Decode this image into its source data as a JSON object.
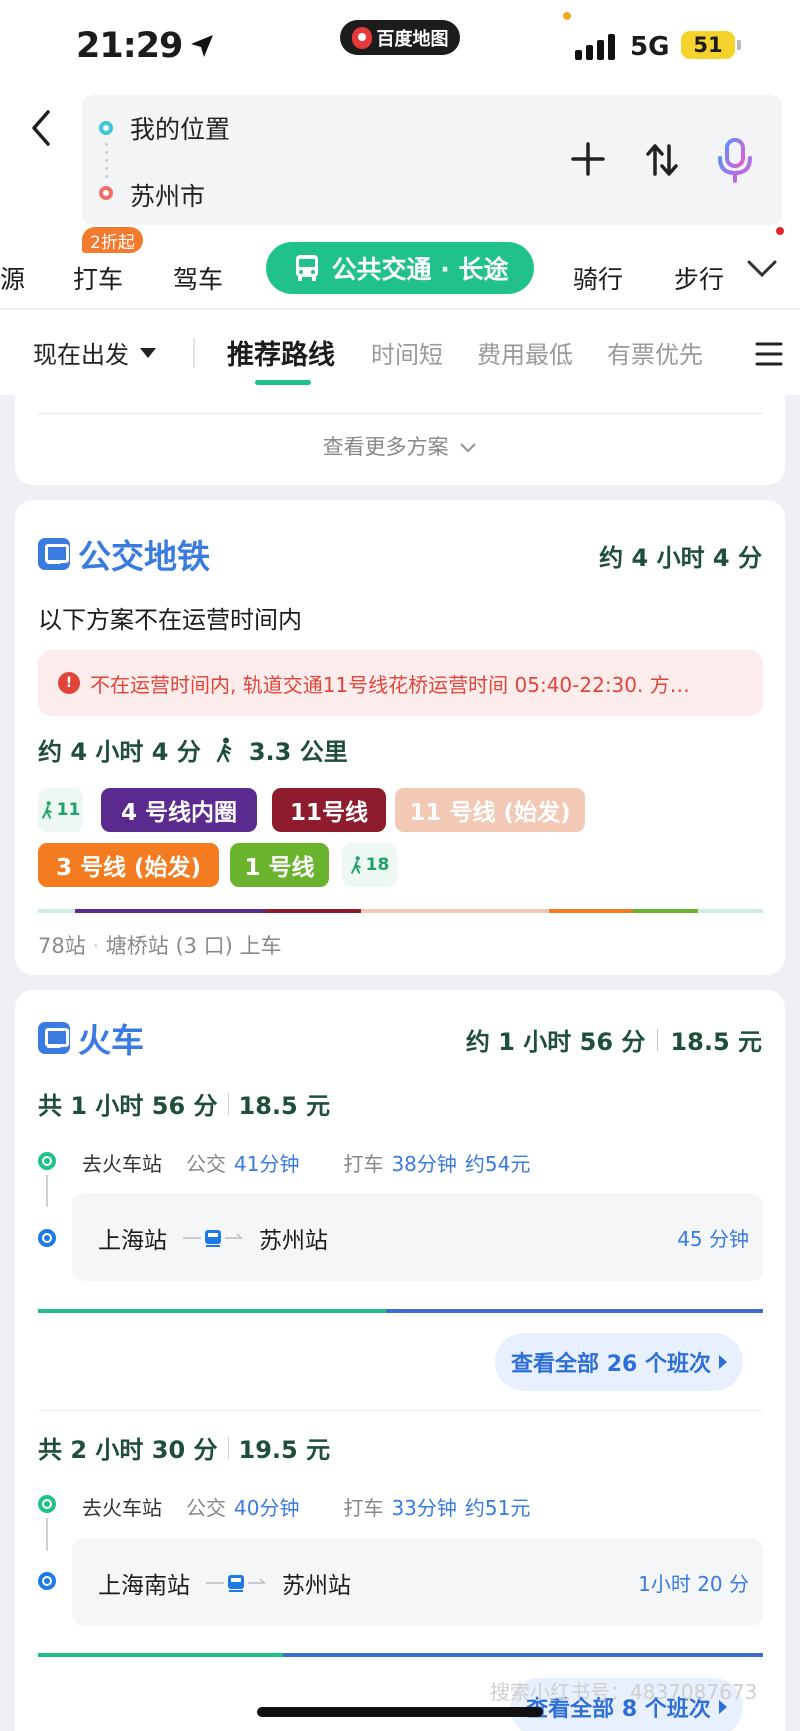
{
  "status": {
    "time": "21:29",
    "app_pill": "百度地图",
    "network": "5G",
    "battery": "51"
  },
  "search": {
    "from": "我的位置",
    "to": "苏州市"
  },
  "modes": {
    "items": [
      "源",
      "打车",
      "驾车",
      "公共交通 · 长途",
      "骑行",
      "步行"
    ],
    "taxi_badge": "2折起"
  },
  "filters": {
    "depart": "现在出发",
    "tabs": [
      "推荐路线",
      "时间短",
      "费用最低",
      "有票优先"
    ]
  },
  "more_plans": "查看更多方案",
  "bus": {
    "title": "公交地铁",
    "duration": "约 4 小时 4 分",
    "notice": "以下方案不在运营时间内",
    "alert": "不在运营时间内, 轨道交通11号线花桥运营时间 05:40-22:30. 方…",
    "summary_time": "约 4 小时 4 分",
    "summary_walk": "3.3 公里",
    "walk1": "11",
    "walk2": "18",
    "lines": [
      "4 号线内圈",
      "11号线",
      "11 号线 (始发)",
      "3 号线 (始发)",
      "1 号线"
    ],
    "stops": "78站",
    "board": "塘桥站 (3 口) 上车"
  },
  "train": {
    "title": "火车",
    "duration": "约 1 小时 56 分",
    "price": "18.5 元",
    "options": [
      {
        "total": "共 1 小时 56 分",
        "price": "18.5 元",
        "goto": "去火车站",
        "bus_label": "公交",
        "bus_time": "41分钟",
        "taxi_label": "打车",
        "taxi_time": "38分钟",
        "taxi_price": "约54元",
        "from": "上海站",
        "to": "苏州站",
        "ride": "45 分钟",
        "view_all": "查看全部 26 个班次"
      },
      {
        "total": "共 2 小时 30 分",
        "price": "19.5 元",
        "goto": "去火车站",
        "bus_label": "公交",
        "bus_time": "40分钟",
        "taxi_label": "打车",
        "taxi_time": "33分钟",
        "taxi_price": "约51元",
        "from": "上海南站",
        "to": "苏州站",
        "ride": "1小时 20 分",
        "view_all": "查看全部 8 个班次"
      }
    ]
  },
  "colors": {
    "accent": "#20c28a",
    "blue": "#3a7be0",
    "line4": "#5b2a8e",
    "line11": "#8e1c2c",
    "line11start": "#f1c9b4",
    "line3": "#f47b1f",
    "line1": "#6ab42d"
  },
  "watermark": "搜索小红书号：4837087673"
}
